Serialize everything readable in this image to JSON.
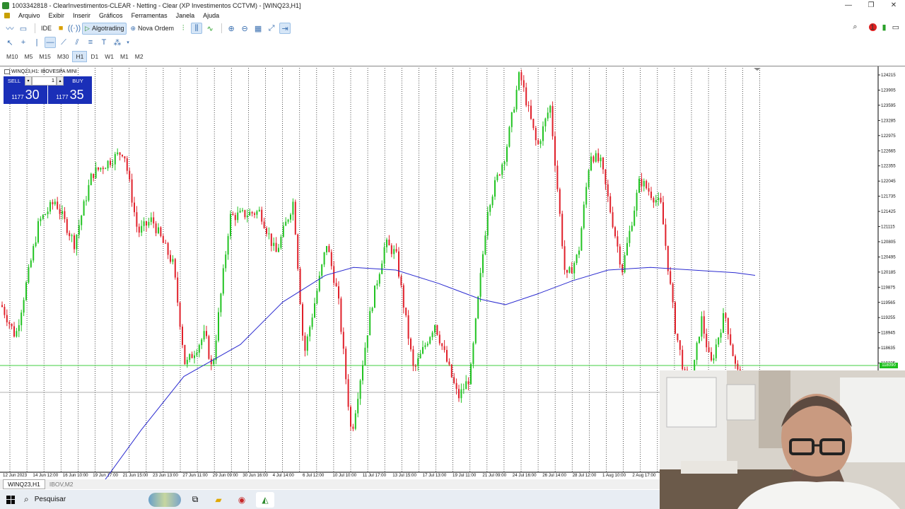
{
  "window": {
    "title": "1003342818 - ClearInvestimentos-CLEAR - Netting - Clear (XP Investimentos CCTVM) - [WINQ23,H1]",
    "controls": [
      "—",
      "❐",
      "✕"
    ]
  },
  "menu": {
    "items": [
      "Arquivo",
      "Exibir",
      "Inserir",
      "Gráficos",
      "Ferramentas",
      "Janela",
      "Ajuda"
    ]
  },
  "toolbar": {
    "ide_label": "IDE",
    "algotrading_label": "Algotrading",
    "nova_ordem_label": "Nova Ordem",
    "notification_count": "1"
  },
  "timeframes": {
    "items": [
      "M10",
      "M5",
      "M15",
      "M30",
      "H1",
      "D1",
      "W1",
      "M1",
      "M2"
    ],
    "active": "H1"
  },
  "chart": {
    "symbol_label": "WINQ23,H1: IBOVESPA MINI",
    "trade_panel": {
      "sell_label": "SELL",
      "buy_label": "BUY",
      "lot": "1",
      "bid_prefix": "1177",
      "bid_big": "30",
      "ask_prefix": "1177",
      "ask_big": "35"
    },
    "current_price_label": "118090",
    "colors": {
      "bull": "#22c322",
      "bear": "#e0202a",
      "ma": "#2b2bd0",
      "grid": "#222222",
      "price_line": "#3fcf3f"
    }
  },
  "chart_data": {
    "type": "candlestick",
    "y_axis_labels": [
      "124215",
      "123905",
      "123595",
      "123285",
      "122975",
      "122665",
      "122355",
      "122045",
      "121735",
      "121425",
      "121115",
      "120805",
      "120495",
      "120185",
      "119875",
      "119565",
      "119255",
      "118945",
      "118635",
      "118325"
    ],
    "x_axis_labels": [
      "12 Jun 2023",
      "14 Jun 12:00",
      "16 Jun 10:00",
      "19 Jun 17:00",
      "21 Jun 15:00",
      "23 Jun 13:00",
      "27 Jun 11:00",
      "29 Jun 09:00",
      "30 Jun 16:00",
      "4 Jul 14:00",
      "6 Jul 12:00",
      "10 Jul 10:00",
      "11 Jul 17:00",
      "13 Jul 15:00",
      "17 Jul 13:00",
      "19 Jul 11:00",
      "21 Jul 09:00",
      "24 Jul 16:00",
      "26 Jul 14:00",
      "28 Jul 12:00",
      "1 Aug 10:00",
      "2 Aug 17:00"
    ],
    "price_path": [
      [
        0,
        119900
      ],
      [
        22,
        119250
      ],
      [
        55,
        121400
      ],
      [
        78,
        121800
      ],
      [
        105,
        121000
      ],
      [
        130,
        122300
      ],
      [
        175,
        122750
      ],
      [
        195,
        121200
      ],
      [
        215,
        121450
      ],
      [
        245,
        120600
      ],
      [
        262,
        118700
      ],
      [
        290,
        119300
      ],
      [
        300,
        118600
      ],
      [
        325,
        121500
      ],
      [
        368,
        121600
      ],
      [
        390,
        120800
      ],
      [
        415,
        121800
      ],
      [
        430,
        118900
      ],
      [
        462,
        121000
      ],
      [
        478,
        120000
      ],
      [
        497,
        117400
      ],
      [
        525,
        119800
      ],
      [
        545,
        121000
      ],
      [
        560,
        120800
      ],
      [
        585,
        118600
      ],
      [
        615,
        119500
      ],
      [
        648,
        118100
      ],
      [
        665,
        118500
      ],
      [
        690,
        121700
      ],
      [
        715,
        122700
      ],
      [
        735,
        124200
      ],
      [
        760,
        122800
      ],
      [
        778,
        123600
      ],
      [
        800,
        120300
      ],
      [
        818,
        120800
      ],
      [
        835,
        122700
      ],
      [
        850,
        122500
      ],
      [
        880,
        120500
      ],
      [
        905,
        122200
      ],
      [
        935,
        121700
      ],
      [
        955,
        119400
      ],
      [
        975,
        118100
      ],
      [
        992,
        119600
      ],
      [
        1005,
        118700
      ],
      [
        1025,
        119700
      ],
      [
        1040,
        118700
      ],
      [
        1060,
        117900
      ],
      [
        1068,
        118090
      ]
    ],
    "moving_average": [
      [
        140,
        116400
      ],
      [
        200,
        117500
      ],
      [
        260,
        118500
      ],
      [
        340,
        119100
      ],
      [
        400,
        119900
      ],
      [
        460,
        120400
      ],
      [
        500,
        120550
      ],
      [
        560,
        120500
      ],
      [
        620,
        120250
      ],
      [
        680,
        119950
      ],
      [
        715,
        119850
      ],
      [
        760,
        120050
      ],
      [
        810,
        120300
      ],
      [
        860,
        120500
      ],
      [
        920,
        120550
      ],
      [
        980,
        120500
      ],
      [
        1040,
        120450
      ],
      [
        1068,
        120400
      ]
    ],
    "y_range": [
      116700,
      124300
    ]
  },
  "tabs": {
    "items": [
      "WINQ23,H1",
      "IBOV,M2"
    ],
    "active": 0
  },
  "taskbar": {
    "search_label": "Pesquisar"
  }
}
